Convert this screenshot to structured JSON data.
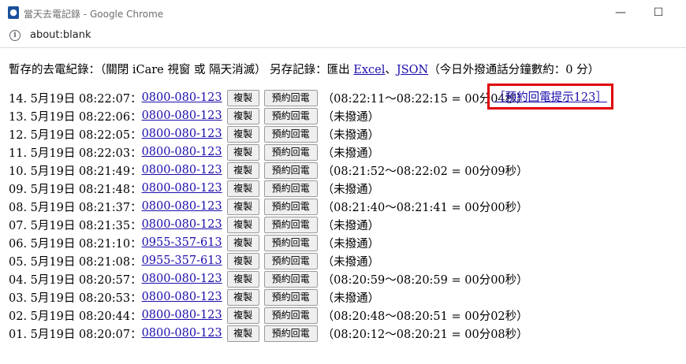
{
  "window": {
    "title": "當天去電記錄 - Google Chrome",
    "minimize": "—",
    "maximize": "☐"
  },
  "address": {
    "url": "about:blank"
  },
  "header": {
    "prefix": "暫存的去電紀錄：（關閉 iCare 視窗 或 隔天消滅） 另存記錄：匯出 ",
    "excel": "Excel",
    "sep": "、",
    "json": "JSON",
    "suffix": "（今日外撥通話分鐘數約：0 分）"
  },
  "buttons": {
    "copy": "複製",
    "callback": "預約回電"
  },
  "reminder": "［預約回電提示123］",
  "records": [
    {
      "prefix": "14. 5月19日 08:22:07：",
      "phone": "0800-080-123",
      "status": "（08:22:11～08:22:15 = 00分04秒）"
    },
    {
      "prefix": "13. 5月19日 08:22:06：",
      "phone": "0800-080-123",
      "status": "（未撥通）"
    },
    {
      "prefix": "12. 5月19日 08:22:05：",
      "phone": "0800-080-123",
      "status": "（未撥通）"
    },
    {
      "prefix": "11. 5月19日 08:22:03：",
      "phone": "0800-080-123",
      "status": "（未撥通）"
    },
    {
      "prefix": "10. 5月19日 08:21:49：",
      "phone": "0800-080-123",
      "status": "（08:21:52～08:22:02 = 00分09秒）"
    },
    {
      "prefix": "09. 5月19日 08:21:48：",
      "phone": "0800-080-123",
      "status": "（未撥通）"
    },
    {
      "prefix": "08. 5月19日 08:21:37：",
      "phone": "0800-080-123",
      "status": "（08:21:40～08:21:41 = 00分00秒）"
    },
    {
      "prefix": "07. 5月19日 08:21:35：",
      "phone": "0800-080-123",
      "status": "（未撥通）"
    },
    {
      "prefix": "06. 5月19日 08:21:10：",
      "phone": "0955-357-613",
      "status": "（未撥通）"
    },
    {
      "prefix": "05. 5月19日 08:21:08：",
      "phone": "0955-357-613",
      "status": "（未撥通）"
    },
    {
      "prefix": "04. 5月19日 08:20:57：",
      "phone": "0800-080-123",
      "status": "（08:20:59～08:20:59 = 00分00秒）"
    },
    {
      "prefix": "03. 5月19日 08:20:53：",
      "phone": "0800-080-123",
      "status": "（未撥通）"
    },
    {
      "prefix": "02. 5月19日 08:20:44：",
      "phone": "0800-080-123",
      "status": "（08:20:48～08:20:51 = 00分02秒）"
    },
    {
      "prefix": "01. 5月19日 08:20:07：",
      "phone": "0800-080-123",
      "status": "（08:20:12～08:20:21 = 00分08秒）"
    }
  ]
}
